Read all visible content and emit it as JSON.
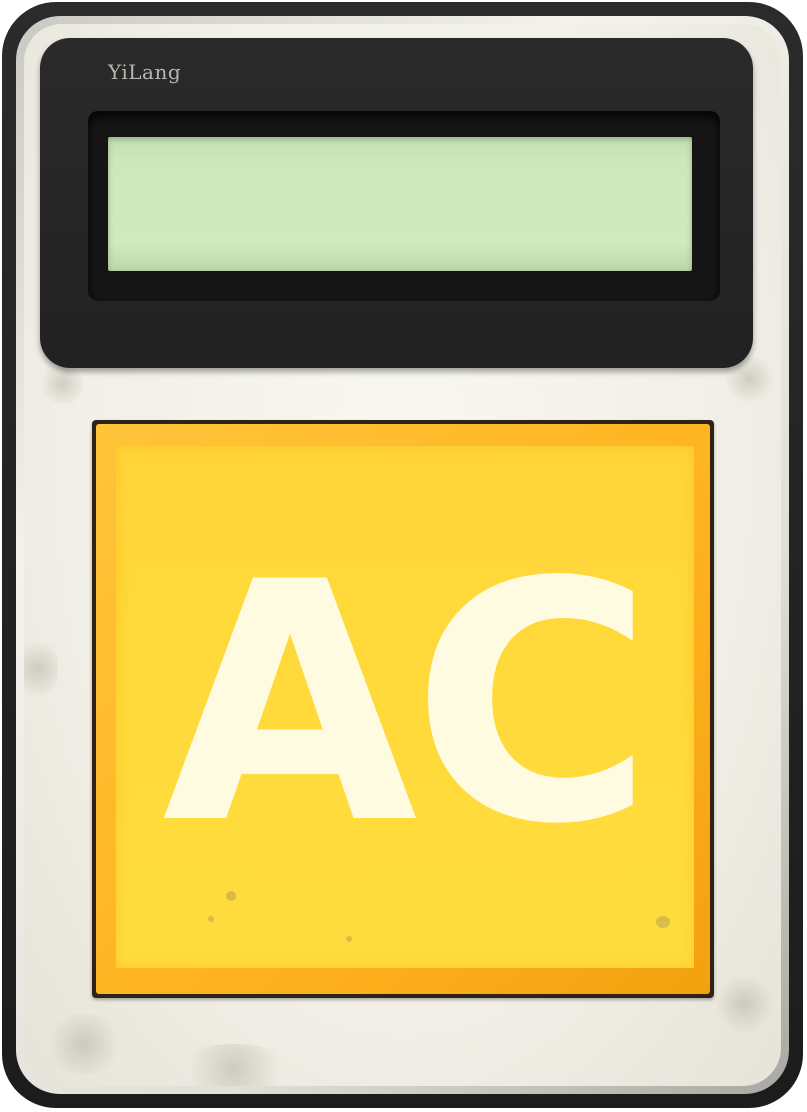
{
  "device": {
    "brand": "YiLang",
    "display_value": ""
  },
  "keys": [
    {
      "label": "AC",
      "color": "#ffd83a",
      "text_color": "#fffbe1"
    }
  ],
  "colors": {
    "body": "#f3f1e9",
    "bezel": "#262626",
    "lcd": "#cde9bb",
    "key": "#ffd83a",
    "key_edge": "#ffb21f"
  }
}
